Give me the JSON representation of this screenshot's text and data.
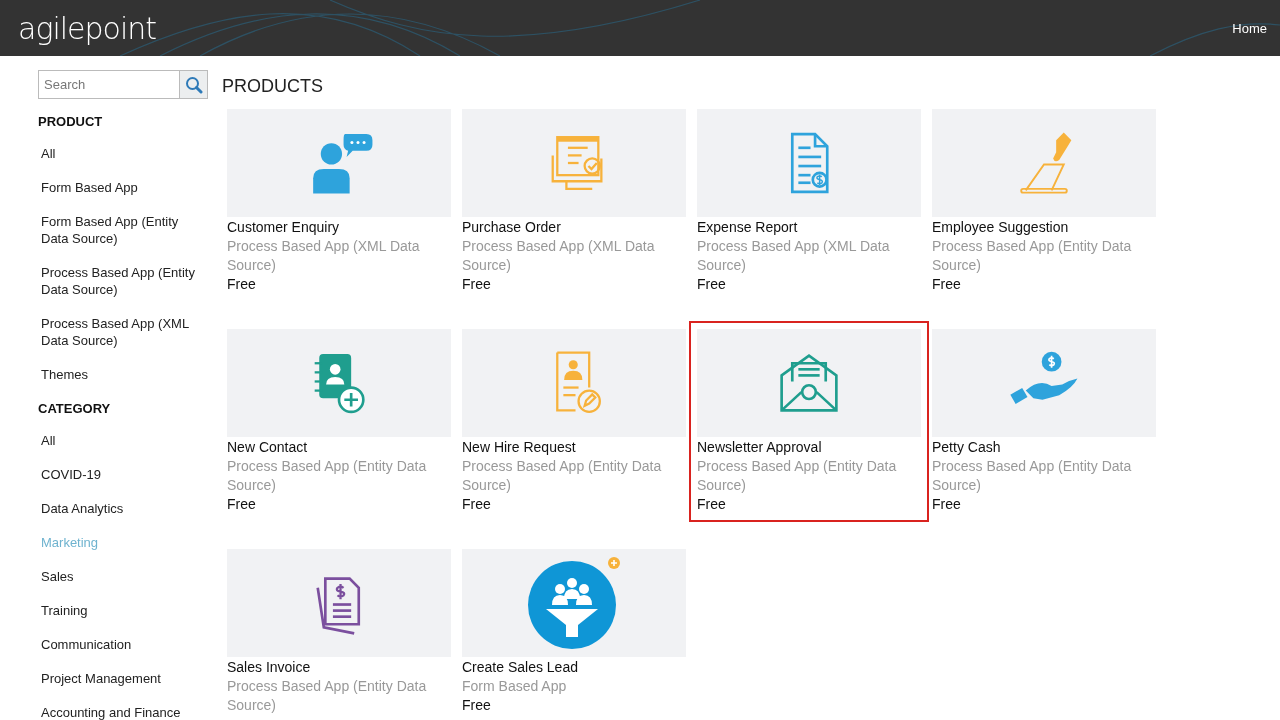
{
  "header": {
    "logo": "agilepoint",
    "nav_link": "Home"
  },
  "search": {
    "placeholder": "Search"
  },
  "sidebar": {
    "sections": [
      {
        "heading": "PRODUCT",
        "items": [
          {
            "label": "All",
            "selected": false
          },
          {
            "label": "Form Based App",
            "selected": false
          },
          {
            "label": "Form Based App (Entity Data Source)",
            "selected": false
          },
          {
            "label": "Process Based App (Entity Data Source)",
            "selected": false
          },
          {
            "label": "Process Based App (XML Data Source)",
            "selected": false
          },
          {
            "label": "Themes",
            "selected": false
          }
        ]
      },
      {
        "heading": "CATEGORY",
        "items": [
          {
            "label": "All",
            "selected": false
          },
          {
            "label": "COVID-19",
            "selected": false
          },
          {
            "label": "Data Analytics",
            "selected": false
          },
          {
            "label": "Marketing",
            "selected": true
          },
          {
            "label": "Sales",
            "selected": false
          },
          {
            "label": "Training",
            "selected": false
          },
          {
            "label": "Communication",
            "selected": false
          },
          {
            "label": "Project Management",
            "selected": false
          },
          {
            "label": "Accounting and Finance",
            "selected": false
          }
        ]
      }
    ]
  },
  "products": {
    "title": "PRODUCTS",
    "cards": [
      {
        "name": "Customer Enquiry",
        "type": "Process Based App (XML Data Source)",
        "price": "Free",
        "selected": false
      },
      {
        "name": "Purchase Order",
        "type": "Process Based App (XML Data Source)",
        "price": "Free",
        "selected": false
      },
      {
        "name": "Expense Report",
        "type": "Process Based App (XML Data Source)",
        "price": "Free",
        "selected": false
      },
      {
        "name": "Employee Suggestion",
        "type": "Process Based App (Entity Data Source)",
        "price": "Free",
        "selected": false
      },
      {
        "name": "New Contact",
        "type": "Process Based App (Entity Data Source)",
        "price": "Free",
        "selected": false
      },
      {
        "name": "New Hire Request",
        "type": "Process Based App (Entity Data Source)",
        "price": "Free",
        "selected": false
      },
      {
        "name": "Newsletter Approval",
        "type": "Process Based App (Entity Data Source)",
        "price": "Free",
        "selected": true
      },
      {
        "name": "Petty Cash",
        "type": "Process Based App (Entity Data Source)",
        "price": "Free",
        "selected": false
      },
      {
        "name": "Sales Invoice",
        "type": "Process Based App (Entity Data Source)",
        "selected": false
      },
      {
        "name": "Create Sales Lead",
        "type": "Form Based App",
        "price": "Free",
        "selected": false
      }
    ]
  }
}
